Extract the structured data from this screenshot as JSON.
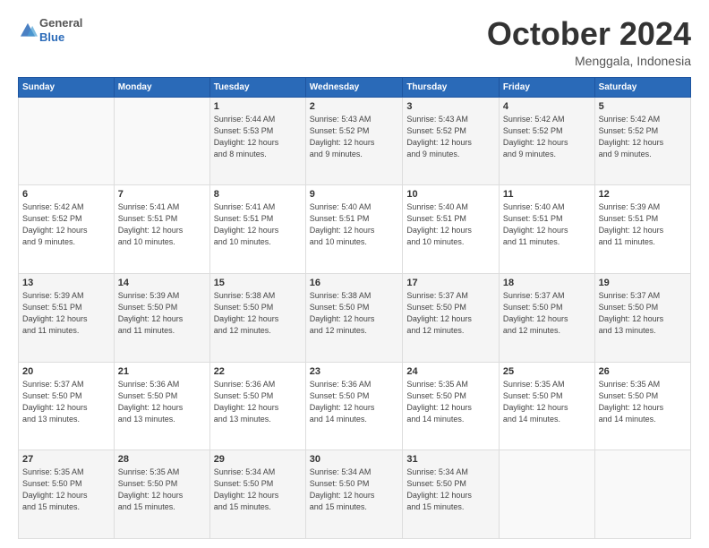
{
  "header": {
    "logo_general": "General",
    "logo_blue": "Blue",
    "month": "October 2024",
    "location": "Menggala, Indonesia"
  },
  "weekdays": [
    "Sunday",
    "Monday",
    "Tuesday",
    "Wednesday",
    "Thursday",
    "Friday",
    "Saturday"
  ],
  "weeks": [
    [
      {
        "day": "",
        "info": ""
      },
      {
        "day": "",
        "info": ""
      },
      {
        "day": "1",
        "info": "Sunrise: 5:44 AM\nSunset: 5:53 PM\nDaylight: 12 hours\nand 8 minutes."
      },
      {
        "day": "2",
        "info": "Sunrise: 5:43 AM\nSunset: 5:52 PM\nDaylight: 12 hours\nand 9 minutes."
      },
      {
        "day": "3",
        "info": "Sunrise: 5:43 AM\nSunset: 5:52 PM\nDaylight: 12 hours\nand 9 minutes."
      },
      {
        "day": "4",
        "info": "Sunrise: 5:42 AM\nSunset: 5:52 PM\nDaylight: 12 hours\nand 9 minutes."
      },
      {
        "day": "5",
        "info": "Sunrise: 5:42 AM\nSunset: 5:52 PM\nDaylight: 12 hours\nand 9 minutes."
      }
    ],
    [
      {
        "day": "6",
        "info": "Sunrise: 5:42 AM\nSunset: 5:52 PM\nDaylight: 12 hours\nand 9 minutes."
      },
      {
        "day": "7",
        "info": "Sunrise: 5:41 AM\nSunset: 5:51 PM\nDaylight: 12 hours\nand 10 minutes."
      },
      {
        "day": "8",
        "info": "Sunrise: 5:41 AM\nSunset: 5:51 PM\nDaylight: 12 hours\nand 10 minutes."
      },
      {
        "day": "9",
        "info": "Sunrise: 5:40 AM\nSunset: 5:51 PM\nDaylight: 12 hours\nand 10 minutes."
      },
      {
        "day": "10",
        "info": "Sunrise: 5:40 AM\nSunset: 5:51 PM\nDaylight: 12 hours\nand 10 minutes."
      },
      {
        "day": "11",
        "info": "Sunrise: 5:40 AM\nSunset: 5:51 PM\nDaylight: 12 hours\nand 11 minutes."
      },
      {
        "day": "12",
        "info": "Sunrise: 5:39 AM\nSunset: 5:51 PM\nDaylight: 12 hours\nand 11 minutes."
      }
    ],
    [
      {
        "day": "13",
        "info": "Sunrise: 5:39 AM\nSunset: 5:51 PM\nDaylight: 12 hours\nand 11 minutes."
      },
      {
        "day": "14",
        "info": "Sunrise: 5:39 AM\nSunset: 5:50 PM\nDaylight: 12 hours\nand 11 minutes."
      },
      {
        "day": "15",
        "info": "Sunrise: 5:38 AM\nSunset: 5:50 PM\nDaylight: 12 hours\nand 12 minutes."
      },
      {
        "day": "16",
        "info": "Sunrise: 5:38 AM\nSunset: 5:50 PM\nDaylight: 12 hours\nand 12 minutes."
      },
      {
        "day": "17",
        "info": "Sunrise: 5:37 AM\nSunset: 5:50 PM\nDaylight: 12 hours\nand 12 minutes."
      },
      {
        "day": "18",
        "info": "Sunrise: 5:37 AM\nSunset: 5:50 PM\nDaylight: 12 hours\nand 12 minutes."
      },
      {
        "day": "19",
        "info": "Sunrise: 5:37 AM\nSunset: 5:50 PM\nDaylight: 12 hours\nand 13 minutes."
      }
    ],
    [
      {
        "day": "20",
        "info": "Sunrise: 5:37 AM\nSunset: 5:50 PM\nDaylight: 12 hours\nand 13 minutes."
      },
      {
        "day": "21",
        "info": "Sunrise: 5:36 AM\nSunset: 5:50 PM\nDaylight: 12 hours\nand 13 minutes."
      },
      {
        "day": "22",
        "info": "Sunrise: 5:36 AM\nSunset: 5:50 PM\nDaylight: 12 hours\nand 13 minutes."
      },
      {
        "day": "23",
        "info": "Sunrise: 5:36 AM\nSunset: 5:50 PM\nDaylight: 12 hours\nand 14 minutes."
      },
      {
        "day": "24",
        "info": "Sunrise: 5:35 AM\nSunset: 5:50 PM\nDaylight: 12 hours\nand 14 minutes."
      },
      {
        "day": "25",
        "info": "Sunrise: 5:35 AM\nSunset: 5:50 PM\nDaylight: 12 hours\nand 14 minutes."
      },
      {
        "day": "26",
        "info": "Sunrise: 5:35 AM\nSunset: 5:50 PM\nDaylight: 12 hours\nand 14 minutes."
      }
    ],
    [
      {
        "day": "27",
        "info": "Sunrise: 5:35 AM\nSunset: 5:50 PM\nDaylight: 12 hours\nand 15 minutes."
      },
      {
        "day": "28",
        "info": "Sunrise: 5:35 AM\nSunset: 5:50 PM\nDaylight: 12 hours\nand 15 minutes."
      },
      {
        "day": "29",
        "info": "Sunrise: 5:34 AM\nSunset: 5:50 PM\nDaylight: 12 hours\nand 15 minutes."
      },
      {
        "day": "30",
        "info": "Sunrise: 5:34 AM\nSunset: 5:50 PM\nDaylight: 12 hours\nand 15 minutes."
      },
      {
        "day": "31",
        "info": "Sunrise: 5:34 AM\nSunset: 5:50 PM\nDaylight: 12 hours\nand 15 minutes."
      },
      {
        "day": "",
        "info": ""
      },
      {
        "day": "",
        "info": ""
      }
    ]
  ]
}
